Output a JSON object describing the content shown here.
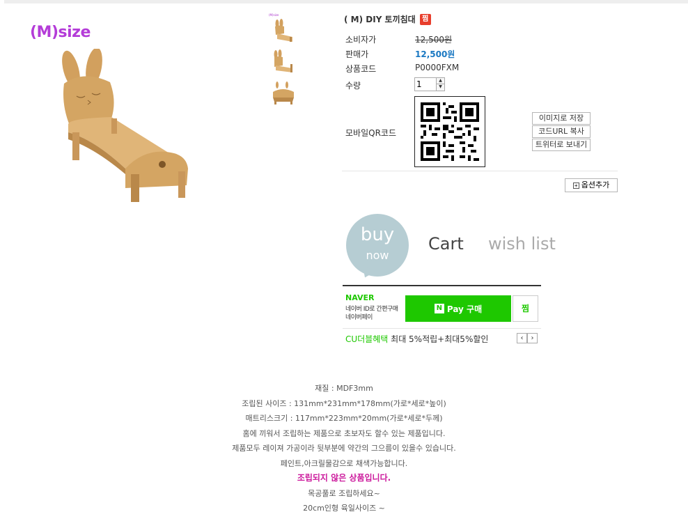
{
  "product": {
    "size_label": "(M)size",
    "thumb_label": "(M)size",
    "title": "( M) DIY 토끼침대",
    "title_badge": "찜"
  },
  "info": {
    "consumer_price_label": "소비자가",
    "consumer_price": "12,500원",
    "sale_price_label": "판매가",
    "sale_price": "12,500원",
    "code_label": "상품코드",
    "code": "P0000FXM",
    "qty_label": "수량",
    "qty_value": "1",
    "qr_label": "모바일QR코드"
  },
  "qr_buttons": {
    "save_image": "이미지로 저장",
    "copy_url": "코드URL 복사",
    "twitter": "트위터로 보내기"
  },
  "option_add": "옵션추가",
  "actions": {
    "buy": "buy",
    "now": "now",
    "cart": "Cart",
    "wishlist": "wish list"
  },
  "naver": {
    "logo": "NAVER",
    "sub1": "네이버 ID로 간편구매",
    "sub2": "네이버페이",
    "pay_n": "N",
    "pay_label": "Pay 구매",
    "zzim": "찜",
    "cu_label": "CU더블혜택",
    "cu_text": "최대 5%적립+최대5%할인",
    "prev": "‹",
    "next": "›"
  },
  "description": [
    "재질 :   MDF3mm",
    "조립된 사이즈 : 131mm*231mm*178mm(가로*세로*높이)",
    "매트리스크기 : 117mm*223mm*20mm(가로*세로*두께)",
    "홈에 끼워서 조립하는 제품으로 초보자도 할수 있는 제품입니다.",
    "제품모두 레이져 가공이라   뒷부분에 약간의 그으름이 있을수 있습니다.",
    "페인트,아크릴물감으로 채색가능합니다.",
    "조립되지 않은 상품입니다.",
    "목공풀로 조립하세요~",
    "20cm인형 육일사이즈 ~"
  ],
  "colors": {
    "accent_price": "#1a78c2",
    "naver_green": "#1ec800",
    "size_purple": "#b43cd8",
    "highlight_pink": "#cc1a9c"
  }
}
